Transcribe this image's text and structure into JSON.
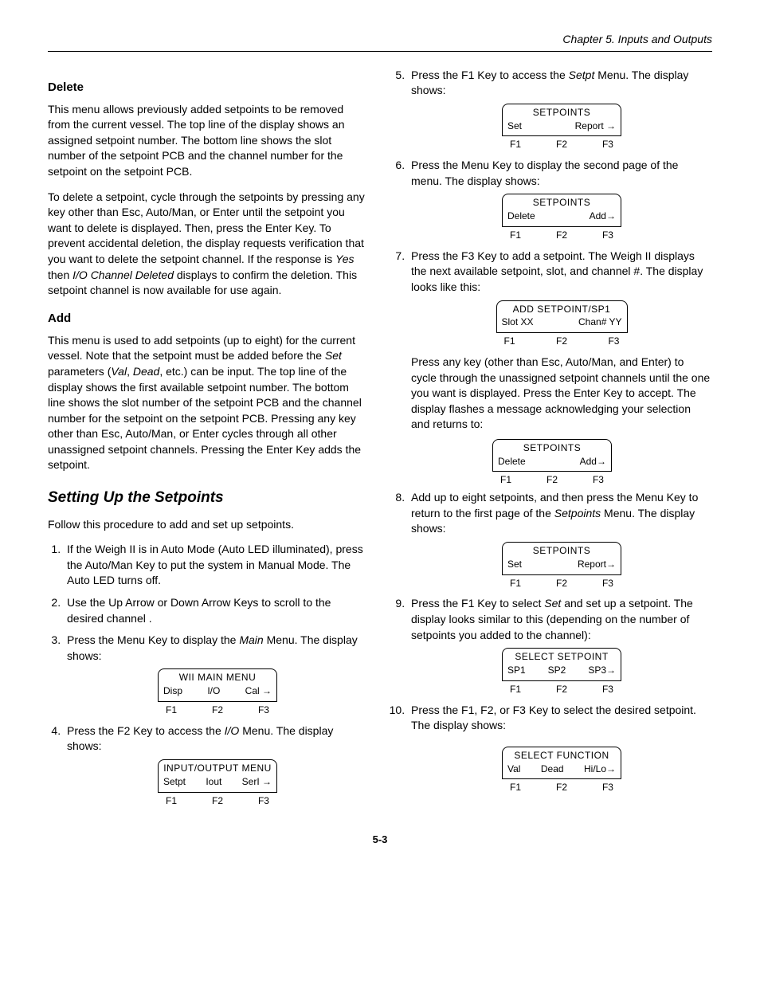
{
  "header": {
    "chapter": "Chapter 5. Inputs and Outputs"
  },
  "left": {
    "delete_head": "Delete",
    "delete_p1": "This menu allows previously added setpoints to be removed from the current vessel. The top line of the display shows an assigned setpoint number. The bottom line shows the slot number of the setpoint PCB and the channel number for the setpoint on the setpoint PCB.",
    "delete_p2a": "To delete a setpoint, cycle through the setpoints by pressing any key other than Esc, Auto/Man, or Enter until the setpoint you want to delete is displayed. Then, press the Enter Key. To prevent accidental deletion, the display requests verification that you want to delete the setpoint channel. If the response is ",
    "delete_p2_yes": "Yes",
    "delete_p2b": " then ",
    "delete_p2_io": "I/O Channel Deleted",
    "delete_p2c": " displays to confirm the deletion. This setpoint channel is now available for use again.",
    "add_head": "Add",
    "add_p1a": "This menu is used to add setpoints (up to eight) for the current vessel. Note that the setpoint must be added before the ",
    "add_p1_set": "Set",
    "add_p1b": " parameters (",
    "add_p1_val": "Val",
    "add_p1c": ", ",
    "add_p1_dead": "Dead",
    "add_p1d": ", etc.) can be input. The top line of the display shows the first available setpoint number. The bottom line shows the slot number of the setpoint PCB and the channel number for the setpoint on the setpoint PCB. Pressing any key other than Esc, Auto/Man, or Enter cycles through all other unassigned setpoint channels. Pressing the Enter Key adds the setpoint.",
    "setup_head": "Setting Up the Setpoints",
    "setup_intro": "Follow this procedure to add and set up setpoints.",
    "step1": "If the Weigh II is in Auto Mode (Auto LED illuminated), press the Auto/Man Key to put the system in Manual Mode. The Auto LED turns off.",
    "step2": "Use the Up Arrow or Down Arrow Keys to scroll to the desired channel .",
    "step3a": "Press the Menu Key to display the ",
    "step3_main": "Main",
    "step3b": " Menu. The display shows:",
    "step4a": "Press the F2 Key to access the ",
    "step4_io": "I/O",
    "step4b": " Menu. The display shows:"
  },
  "right": {
    "step5a": "Press the F1 Key to access the ",
    "step5_setpt": "Setpt",
    "step5b": " Menu. The display shows:",
    "step6": "Press the Menu Key to display the second page of the menu. The display shows:",
    "step7": "Press the F3 Key to add a setpoint. The Weigh II displays the next available setpoint, slot, and channel #. The display looks like this:",
    "step7_cont": "Press any key (other than Esc, Auto/Man, and Enter) to cycle through the unassigned setpoint channels until the one you want is displayed. Press the Enter Key to accept. The display flashes a message acknowledging your selection and returns to:",
    "step8a": "Add up to eight setpoints, and then press the Menu Key to return to the first page of the ",
    "step8_setpoints": "Setpoints",
    "step8b": " Menu. The display shows:",
    "step9a": "Press the F1 Key to select ",
    "step9_set": "Set",
    "step9b": " and set up a setpoint. The display looks similar to this (depending on the number of setpoints you added to the channel):",
    "step10": "Press the F1, F2, or F3 Key to select the desired setpoint. The display shows:"
  },
  "displays": {
    "main": {
      "title": "WII MAIN MENU",
      "l": "Disp",
      "m": "I/O",
      "r": "Cal →"
    },
    "io": {
      "title": "INPUT/OUTPUT MENU",
      "l": "Setpt",
      "m": "Iout",
      "r": "SerI →"
    },
    "setpoints1": {
      "title": "SETPOINTS",
      "l": "Set",
      "m": "",
      "r": "Report →"
    },
    "setpoints2": {
      "title": "SETPOINTS",
      "l": "Delete",
      "m": "",
      "r": "Add→"
    },
    "addsp": {
      "title": "ADD SETPOINT/SP1",
      "l": "Slot XX",
      "m": "",
      "r": "Chan# YY"
    },
    "setpoints3": {
      "title": "SETPOINTS",
      "l": "Delete",
      "m": "",
      "r": "Add→"
    },
    "setpoints4": {
      "title": "SETPOINTS",
      "l": "Set",
      "m": "",
      "r": "Report→"
    },
    "selectsp": {
      "title": "SELECT SETPOINT",
      "l": "SP1",
      "m": "SP2",
      "r": "SP3→"
    },
    "selectfn": {
      "title": "SELECT FUNCTION",
      "l": "Val",
      "m": "Dead",
      "r": "Hi/Lo→"
    }
  },
  "fkeys": {
    "f1": "F1",
    "f2": "F2",
    "f3": "F3"
  },
  "page_num": "5-3"
}
